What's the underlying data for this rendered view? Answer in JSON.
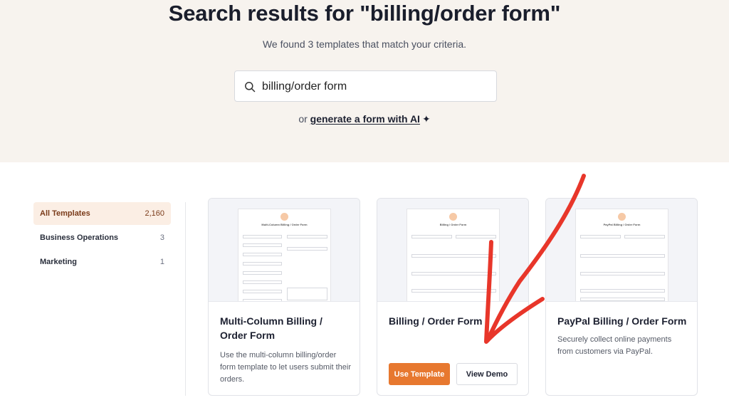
{
  "hero": {
    "title": "Search results for \"billing/order form\"",
    "subtitle": "We found 3 templates that match your criteria.",
    "search_value": "billing/order form",
    "ai_prefix": "or ",
    "ai_link": "generate a form with AI",
    "ai_icon": "sparkle-icon"
  },
  "sidebar": {
    "items": [
      {
        "label": "All Templates",
        "count": "2,160"
      },
      {
        "label": "Business Operations",
        "count": "3"
      },
      {
        "label": "Marketing",
        "count": "1"
      }
    ]
  },
  "cards": [
    {
      "title": "Multi-Column Billing / Order Form",
      "description": "Use the multi-column billing/order form template to let users submit their orders.",
      "preview_title": "Multi-Column Billing / Order Form"
    },
    {
      "title": "Billing / Order Form",
      "description": "",
      "preview_title": "Billing / Order Form",
      "use_label": "Use Template",
      "demo_label": "View Demo"
    },
    {
      "title": "PayPal Billing / Order Form",
      "description": "Securely collect online payments from customers via PayPal.",
      "preview_title": "PayPal Billing / Order Form"
    }
  ],
  "colors": {
    "hero_bg": "#f7f3ee",
    "accent": "#e7782f",
    "annotation_arrow": "#e8362a"
  }
}
